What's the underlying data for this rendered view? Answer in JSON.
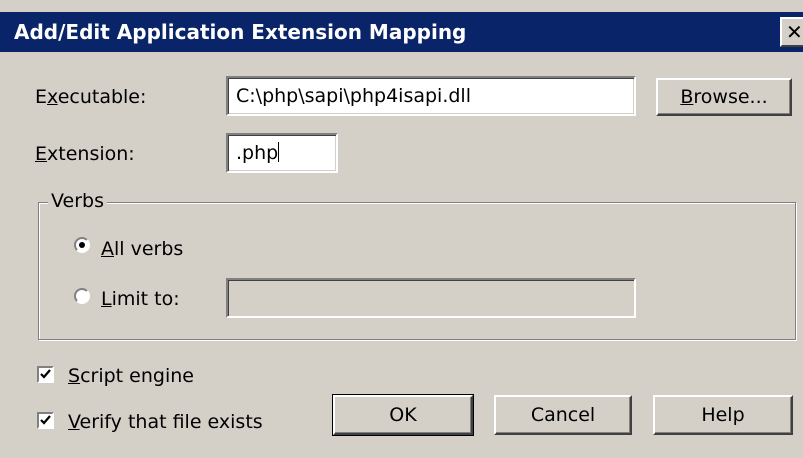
{
  "window": {
    "title": "Add/Edit Application Extension Mapping",
    "close_glyph": "✕"
  },
  "executable": {
    "label_pre": "E",
    "label_accel": "x",
    "label_post": "ecutable:",
    "value": "C:\\php\\sapi\\php4isapi.dll"
  },
  "extension": {
    "label_accel": "E",
    "label_post": "xtension:",
    "value": ".php"
  },
  "browse_button": {
    "accel": "B",
    "rest": "rowse..."
  },
  "verbs": {
    "legend": "Verbs",
    "all_verbs": {
      "accel": "A",
      "rest": "ll verbs",
      "selected": true
    },
    "limit_to": {
      "accel": "L",
      "rest": "imit to:",
      "selected": false,
      "value": ""
    }
  },
  "script_engine": {
    "accel": "S",
    "rest": "cript engine",
    "checked": true
  },
  "verify_file": {
    "accel": "V",
    "rest": "erify that file exists",
    "checked": true
  },
  "buttons": {
    "ok": "OK",
    "cancel": "Cancel",
    "help": "Help"
  }
}
